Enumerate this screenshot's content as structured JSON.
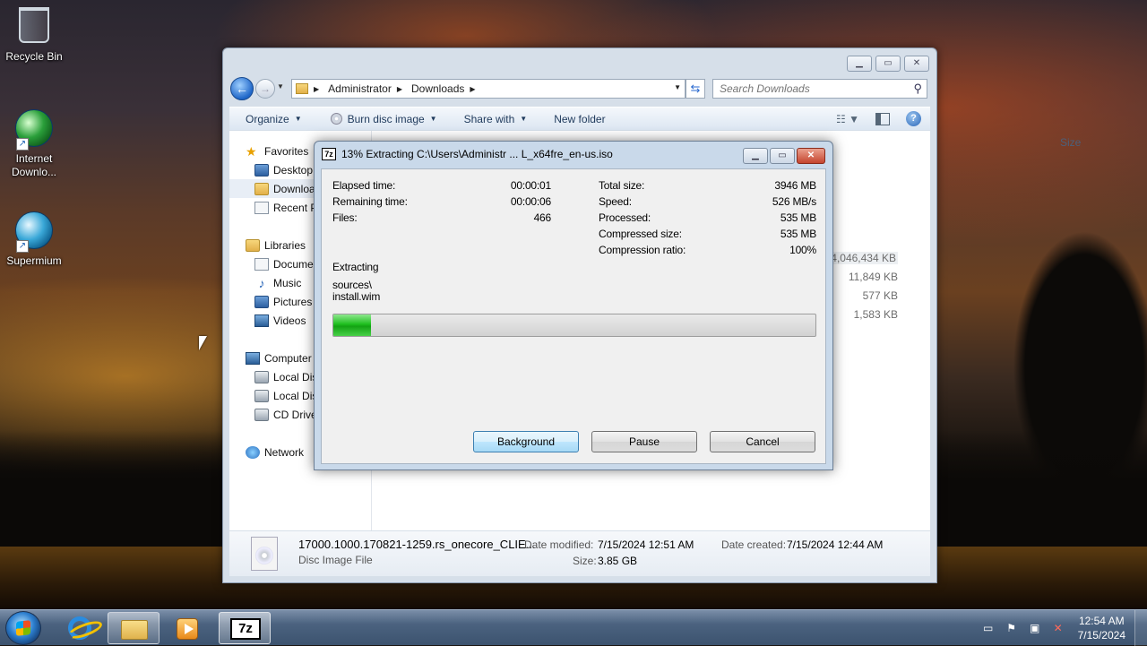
{
  "desktop": {
    "icons": [
      {
        "label": "Recycle Bin",
        "icon": "recycle-bin-icon"
      },
      {
        "label": "Internet Downlo...",
        "icon": "internet-download-manager-icon"
      },
      {
        "label": "Supermium",
        "icon": "supermium-icon"
      }
    ]
  },
  "explorer": {
    "address": {
      "crumbs": [
        "Administrator",
        "Downloads"
      ]
    },
    "search_placeholder": "Search Downloads",
    "commands": {
      "organize": "Organize",
      "burn": "Burn disc image",
      "share": "Share with",
      "new_folder": "New folder"
    },
    "nav": {
      "favorites": "Favorites",
      "desktop": "Desktop",
      "downloads": "Downloa",
      "recent": "Recent P",
      "libraries": "Libraries",
      "documents": "Docume",
      "music": "Music",
      "pictures": "Pictures",
      "videos": "Videos",
      "computer": "Computer",
      "local_disk_1": "Local Dis",
      "local_disk_2": "Local Dis",
      "cd_drive": "CD Drive",
      "network": "Network"
    },
    "columns": {
      "size": "Size"
    },
    "sizes": [
      "4,046,434 KB",
      "11,849 KB",
      "577 KB",
      "1,583 KB"
    ],
    "details": {
      "file_name": "17000.1000.170821-1259.rs_onecore_CLIE...",
      "file_type": "Disc Image File",
      "date_modified_label": "Date modified:",
      "date_modified": "7/15/2024 12:51 AM",
      "date_created_label": "Date created:",
      "date_created": "7/15/2024 12:44 AM",
      "size_label": "Size:",
      "size": "3.85 GB"
    }
  },
  "zip_dialog": {
    "title": "13% Extracting C:\\Users\\Administr ... L_x64fre_en-us.iso",
    "elapsed_label": "Elapsed time:",
    "elapsed": "00:00:01",
    "remaining_label": "Remaining time:",
    "remaining": "00:00:06",
    "files_label": "Files:",
    "files": "466",
    "total_size_label": "Total size:",
    "total_size": "3946 MB",
    "speed_label": "Speed:",
    "speed": "526 MB/s",
    "processed_label": "Processed:",
    "processed": "535 MB",
    "compressed_label": "Compressed size:",
    "compressed": "535 MB",
    "ratio_label": "Compression ratio:",
    "ratio": "100%",
    "status": "Extracting",
    "path_line1": "sources\\",
    "path_line2": "install.wim",
    "progress_percent": 13,
    "buttons": {
      "background": "Background",
      "pause": "Pause",
      "cancel": "Cancel"
    }
  },
  "taskbar": {
    "items": [
      "internet-explorer-icon",
      "windows-explorer-icon",
      "media-player-icon",
      "7zip-icon"
    ],
    "clock_time": "12:54 AM",
    "clock_date": "7/15/2024"
  },
  "colors": {
    "progress": "#1fbf1f",
    "taskbar": "#4b627f",
    "dialog_frame": "#c9d9ea"
  }
}
